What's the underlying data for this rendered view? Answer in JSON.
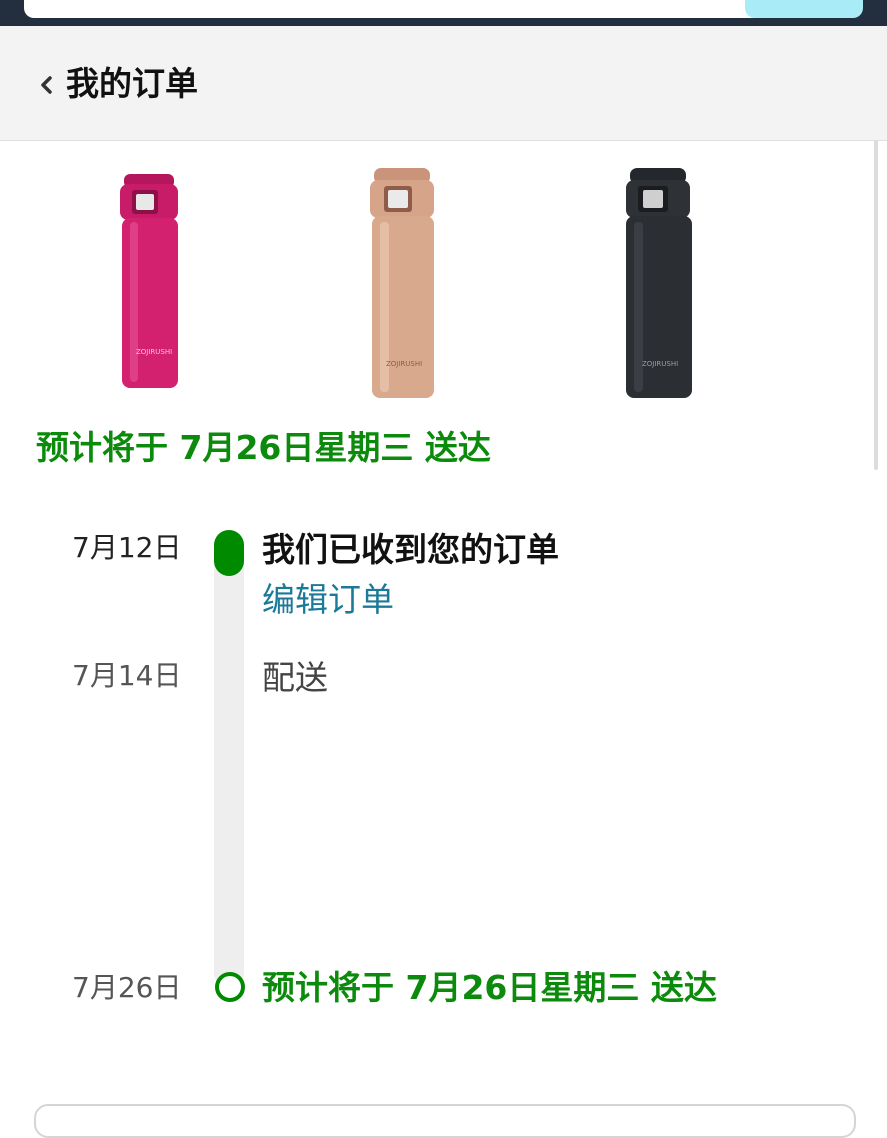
{
  "header": {
    "title": "我的订单"
  },
  "products": [
    {
      "color": "#d3206f",
      "icon": "thermos-bottle-pink"
    },
    {
      "color": "#d8a98c",
      "icon": "thermos-bottle-rose-gold"
    },
    {
      "color": "#2b2e33",
      "icon": "thermos-bottle-black"
    }
  ],
  "delivery": {
    "estimate": "预计将于 7月26日星期三 送达"
  },
  "timeline": [
    {
      "date": "7月12日",
      "text": "我们已收到您的订单",
      "link": "编辑订单",
      "status": "done"
    },
    {
      "date": "7月14日",
      "text": "配送",
      "status": "pending"
    },
    {
      "date": "7月26日",
      "text": "预计将于 7月26日星期三 送达",
      "status": "upcoming"
    }
  ],
  "colors": {
    "accent_green": "#008a00",
    "link_blue": "#1b7a9a",
    "topbar": "#232f3e"
  }
}
